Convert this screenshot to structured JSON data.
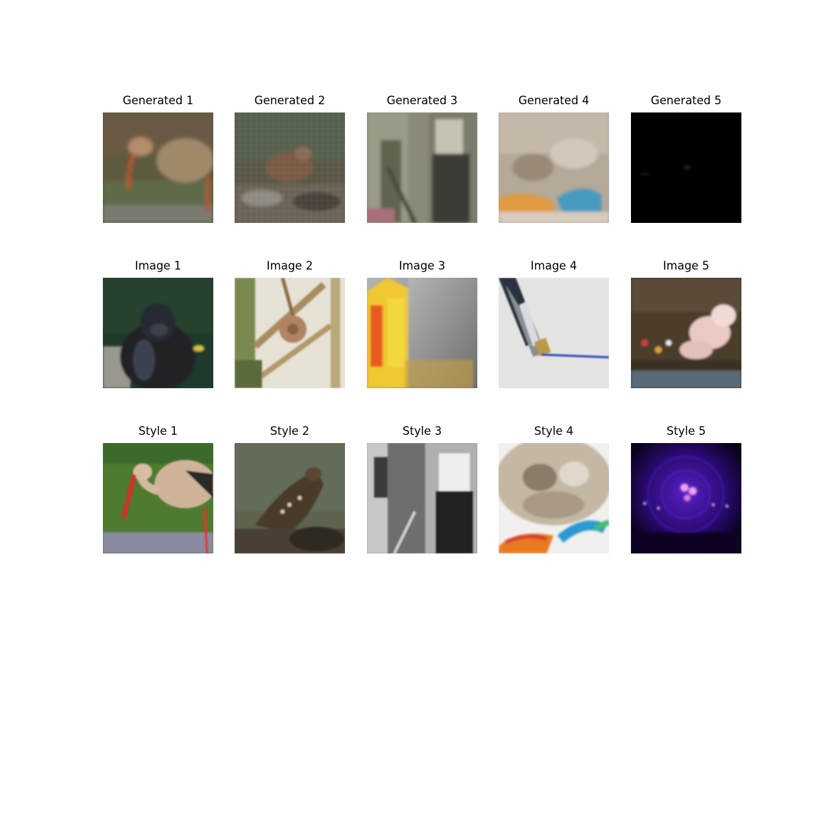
{
  "rows": [
    {
      "row": "generated",
      "panels": [
        {
          "title": "Generated 1",
          "scene": "stork-like bird, blurry, muddy greens and browns"
        },
        {
          "title": "Generated 2",
          "scene": "bird on rocks, pixelated, muted tones"
        },
        {
          "title": "Generated 3",
          "scene": "two figures, desaturated, pixelated"
        },
        {
          "title": "Generated 4",
          "scene": "textured pale scene with orange and blue at bottom"
        },
        {
          "title": "Generated 5",
          "scene": "almost entirely black"
        }
      ]
    },
    {
      "row": "image",
      "panels": [
        {
          "title": "Image 1",
          "scene": "gorilla"
        },
        {
          "title": "Image 2",
          "scene": "padlock and chain on fence"
        },
        {
          "title": "Image 3",
          "scene": "yellow carton beside grey surface"
        },
        {
          "title": "Image 4",
          "scene": "pen drawing a blue line"
        },
        {
          "title": "Image 5",
          "scene": "pink sweets in a shop display"
        }
      ]
    },
    {
      "row": "style",
      "panels": [
        {
          "title": "Style 1",
          "scene": "stork in grass"
        },
        {
          "title": "Style 2",
          "scene": "eagle on rocks"
        },
        {
          "title": "Style 3",
          "scene": "black and white photo of two people"
        },
        {
          "title": "Style 4",
          "scene": "shaggy dog with colourful toy"
        },
        {
          "title": "Style 5",
          "scene": "purple glowing lights"
        }
      ]
    }
  ]
}
